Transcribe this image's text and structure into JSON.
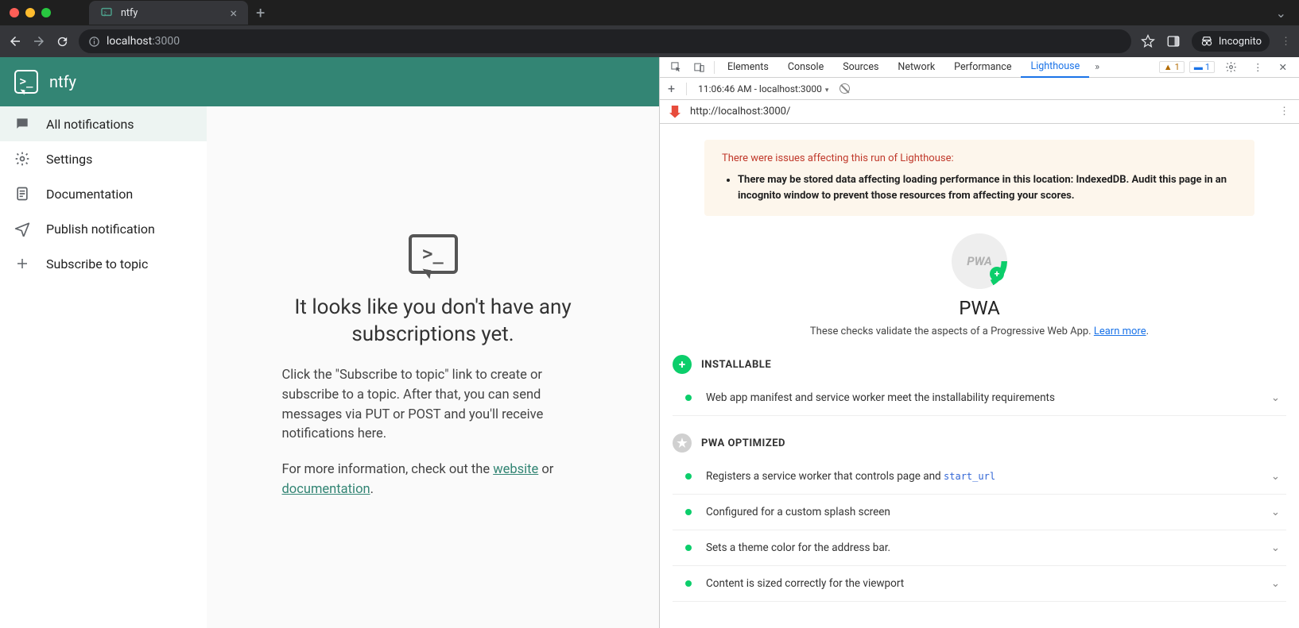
{
  "browser": {
    "tab_title": "ntfy",
    "omnibox_host": "localhost",
    "omnibox_port": ":3000",
    "incognito_label": "Incognito"
  },
  "app": {
    "brand": "ntfy",
    "sidebar": {
      "all_notifications": "All notifications",
      "settings": "Settings",
      "documentation": "Documentation",
      "publish": "Publish notification",
      "subscribe": "Subscribe to topic"
    },
    "empty": {
      "heading": "It looks like you don't have any subscriptions yet.",
      "body1": "Click the \"Subscribe to topic\" link to create or subscribe to a topic. After that, you can send messages via PUT or POST and you'll receive notifications here.",
      "body2_pre": "For more information, check out the ",
      "body2_link1": "website",
      "body2_mid": " or ",
      "body2_link2": "documentation",
      "body2_post": "."
    }
  },
  "devtools": {
    "tabs": {
      "elements": "Elements",
      "console": "Console",
      "sources": "Sources",
      "network": "Network",
      "performance": "Performance",
      "lighthouse": "Lighthouse"
    },
    "warn_count": "1",
    "info_count": "1",
    "subbar_report": "11:06:46 AM - localhost:3000",
    "url": "http://localhost:3000/",
    "lighthouse": {
      "warn_title": "There were issues affecting this run of Lighthouse:",
      "warn_item": "There may be stored data affecting loading performance in this location: IndexedDB. Audit this page in an incognito window to prevent those resources from affecting your scores.",
      "pwa_label": "PWA",
      "pwa_desc_pre": "These checks validate the aspects of a Progressive Web App. ",
      "pwa_desc_link": "Learn more",
      "pwa_desc_post": ".",
      "installable_hd": "INSTALLABLE",
      "optimized_hd": "PWA OPTIMIZED",
      "audit_manifest": "Web app manifest and service worker meet the installability requirements",
      "audit_sw_pre": "Registers a service worker that controls page and ",
      "audit_sw_code": "start_url",
      "audit_splash": "Configured for a custom splash screen",
      "audit_theme": "Sets a theme color for the address bar.",
      "audit_viewport": "Content is sized correctly for the viewport"
    }
  }
}
